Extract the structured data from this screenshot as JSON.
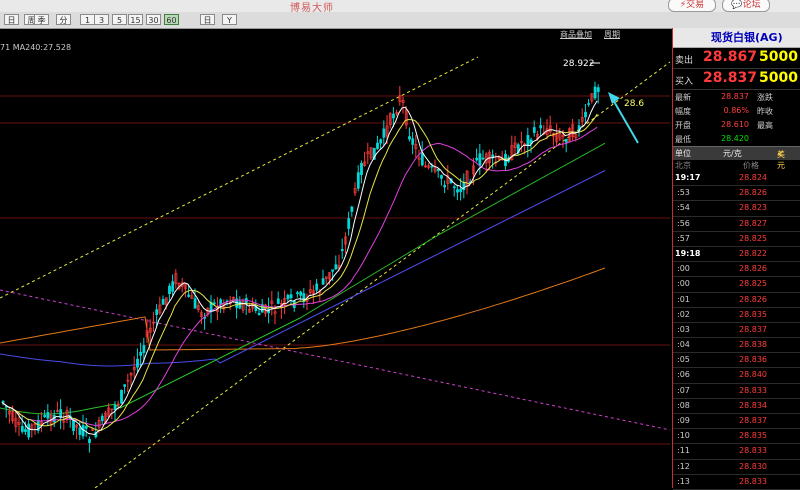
{
  "app": {
    "title": "博易大师"
  },
  "toolbar": {
    "buttons": [
      "日",
      "周",
      "季",
      "分",
      "1",
      "3",
      "5",
      "15",
      "30",
      "60",
      "日",
      "Y"
    ],
    "selected_index": 9,
    "trade_label": "交易",
    "forum_label": "论坛"
  },
  "chart": {
    "ma_label": "71  MA240:27.528",
    "links": [
      "商品叠加",
      "周期"
    ],
    "high_label": "28.922",
    "annotation": "28.6"
  },
  "panel": {
    "title": "现货白银(AG)",
    "sell_label": "卖出",
    "sell_price": "28.867",
    "sell_vol": "5000",
    "buy_label": "买入",
    "buy_price": "28.837",
    "buy_vol": "5000",
    "stats": [
      {
        "k": "最新",
        "v": "28.837",
        "k2": "涨跌",
        "green": false
      },
      {
        "k": "幅度",
        "v": "0.86%",
        "k2": "昨收",
        "green": false
      },
      {
        "k": "开盘",
        "v": "28.610",
        "k2": "最高",
        "green": false
      },
      {
        "k": "最低",
        "v": "28.420",
        "k2": "",
        "green": true
      }
    ],
    "header": {
      "unit": "单位",
      "currency": "元/克",
      "check": "美元"
    },
    "sub": {
      "location": "北京",
      "price": "价格"
    },
    "ticks": [
      {
        "t": "19:17",
        "p": "28.824",
        "bold": true
      },
      {
        "t": ":53",
        "p": "28.826",
        "bold": false
      },
      {
        "t": ":54",
        "p": "28.823",
        "bold": false
      },
      {
        "t": ":56",
        "p": "28.827",
        "bold": false
      },
      {
        "t": ":57",
        "p": "28.825",
        "bold": false
      },
      {
        "t": "19:18",
        "p": "28.822",
        "bold": true
      },
      {
        "t": ":00",
        "p": "28.826",
        "bold": false
      },
      {
        "t": ":00",
        "p": "28.825",
        "bold": false
      },
      {
        "t": ":01",
        "p": "28.826",
        "bold": false
      },
      {
        "t": ":02",
        "p": "28.835",
        "bold": false
      },
      {
        "t": ":03",
        "p": "28.837",
        "bold": false
      },
      {
        "t": ":04",
        "p": "28.838",
        "bold": false
      },
      {
        "t": ":05",
        "p": "28.836",
        "bold": false
      },
      {
        "t": ":06",
        "p": "28.840",
        "bold": false
      },
      {
        "t": ":07",
        "p": "28.833",
        "bold": false
      },
      {
        "t": ":08",
        "p": "28.834",
        "bold": false
      },
      {
        "t": ":09",
        "p": "28.837",
        "bold": false
      },
      {
        "t": ":10",
        "p": "28.835",
        "bold": false
      },
      {
        "t": ":11",
        "p": "28.833",
        "bold": false
      },
      {
        "t": ":12",
        "p": "28.830",
        "bold": false
      },
      {
        "t": ":13",
        "p": "28.833",
        "bold": false
      }
    ]
  },
  "colors": {
    "up": "#ff3a3a",
    "down": "#00d8d8",
    "ma5": "#ffffff",
    "ma10": "#e6e64a",
    "ma20": "#e040e0",
    "ma60": "#28c028",
    "ma120": "#4a4ae8",
    "ma240": "#e07818"
  }
}
